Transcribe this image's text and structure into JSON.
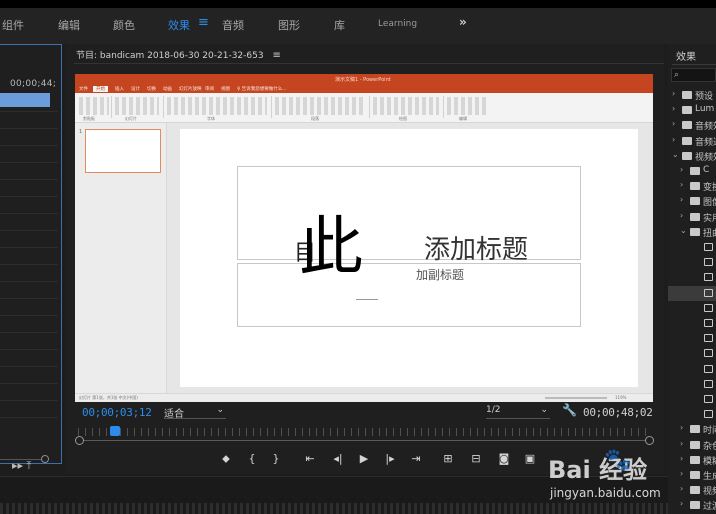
{
  "workspace_tabs": {
    "partial_assemble": "组件",
    "editing": "编辑",
    "color": "颜色",
    "effects": "效果",
    "audio": "音频",
    "graphics": "图形",
    "library": "库",
    "learning": "Learning",
    "more": "»"
  },
  "left_panel": {
    "timecode": "00;00;44;"
  },
  "monitor": {
    "title": "节目: bandicam 2018-06-30 20-21-32-653",
    "menu_glyph": "≡",
    "current_time": "00;00;03;12",
    "fit_label": "适合",
    "resolution": "1/2",
    "duration": "00;00;48;02"
  },
  "ppt": {
    "window_title": "演示文稿1 - PowerPoint",
    "tabs": [
      "文件",
      "开始",
      "插入",
      "设计",
      "切换",
      "动画",
      "幻灯片放映",
      "审阅",
      "视图",
      "♀ 告诉我您想要做什么..."
    ],
    "ribbon_groups": [
      "剪贴板",
      "幻灯片",
      "字体",
      "段落",
      "绘图",
      "编辑"
    ],
    "slide_number": "1",
    "title_placeholder": "添加标题",
    "subtitle_placeholder": "加副标题",
    "overlay_big": "此",
    "overlay_small": "目",
    "status_left": "幻灯片 第1张，共1张   中文(中国)",
    "zoom": "119%"
  },
  "effects_panel": {
    "title": "效果",
    "items": [
      {
        "label": "预设",
        "kind": "folder",
        "level": 0
      },
      {
        "label": "Lum",
        "kind": "folder",
        "level": 0
      },
      {
        "label": "音频效果",
        "kind": "folder",
        "level": 0
      },
      {
        "label": "音频过渡",
        "kind": "folder",
        "level": 0
      },
      {
        "label": "视频效果",
        "kind": "folder",
        "level": 0
      },
      {
        "label": "C",
        "kind": "folder",
        "level": 1
      },
      {
        "label": "变换",
        "kind": "folder",
        "level": 1
      },
      {
        "label": "图像",
        "kind": "folder",
        "level": 1
      },
      {
        "label": "实用",
        "kind": "folder",
        "level": 1
      },
      {
        "label": "扭曲",
        "kind": "folder",
        "level": 1
      },
      {
        "label": "",
        "kind": "preset",
        "level": 2
      },
      {
        "label": "",
        "kind": "preset",
        "level": 2
      },
      {
        "label": "",
        "kind": "preset",
        "level": 2
      },
      {
        "label": "",
        "kind": "preset",
        "level": 2
      },
      {
        "label": "",
        "kind": "preset",
        "level": 2
      },
      {
        "label": "",
        "kind": "preset",
        "level": 2
      },
      {
        "label": "",
        "kind": "preset",
        "level": 2
      },
      {
        "label": "",
        "kind": "preset",
        "level": 2
      },
      {
        "label": "",
        "kind": "preset",
        "level": 2
      },
      {
        "label": "",
        "kind": "preset",
        "level": 2
      },
      {
        "label": "",
        "kind": "preset",
        "level": 2
      },
      {
        "label": "",
        "kind": "preset",
        "level": 2
      },
      {
        "label": "时间",
        "kind": "folder",
        "level": 1
      },
      {
        "label": "杂色",
        "kind": "folder",
        "level": 1
      },
      {
        "label": "模糊",
        "kind": "folder",
        "level": 1
      },
      {
        "label": "生成",
        "kind": "folder",
        "level": 1
      },
      {
        "label": "视频",
        "kind": "folder",
        "level": 1
      },
      {
        "label": "过渡",
        "kind": "folder",
        "level": 1
      }
    ]
  },
  "transport_controls": [
    "marker-icon",
    "mark-in-icon",
    "mark-out-icon",
    "go-to-in-icon",
    "step-back-icon",
    "play-icon",
    "step-forward-icon",
    "go-to-out-icon",
    "insert-icon",
    "overwrite-icon",
    "export-frame-icon",
    "compare-icon"
  ],
  "left_panel_icons": "▸▸ ⤒",
  "watermark": {
    "brand": "Bai  经验",
    "url": "jingyan.baidu.com"
  },
  "colors": {
    "accent": "#2d8ceb",
    "ppt_orange": "#c4451f",
    "panel_bg": "#1f1f1f"
  }
}
